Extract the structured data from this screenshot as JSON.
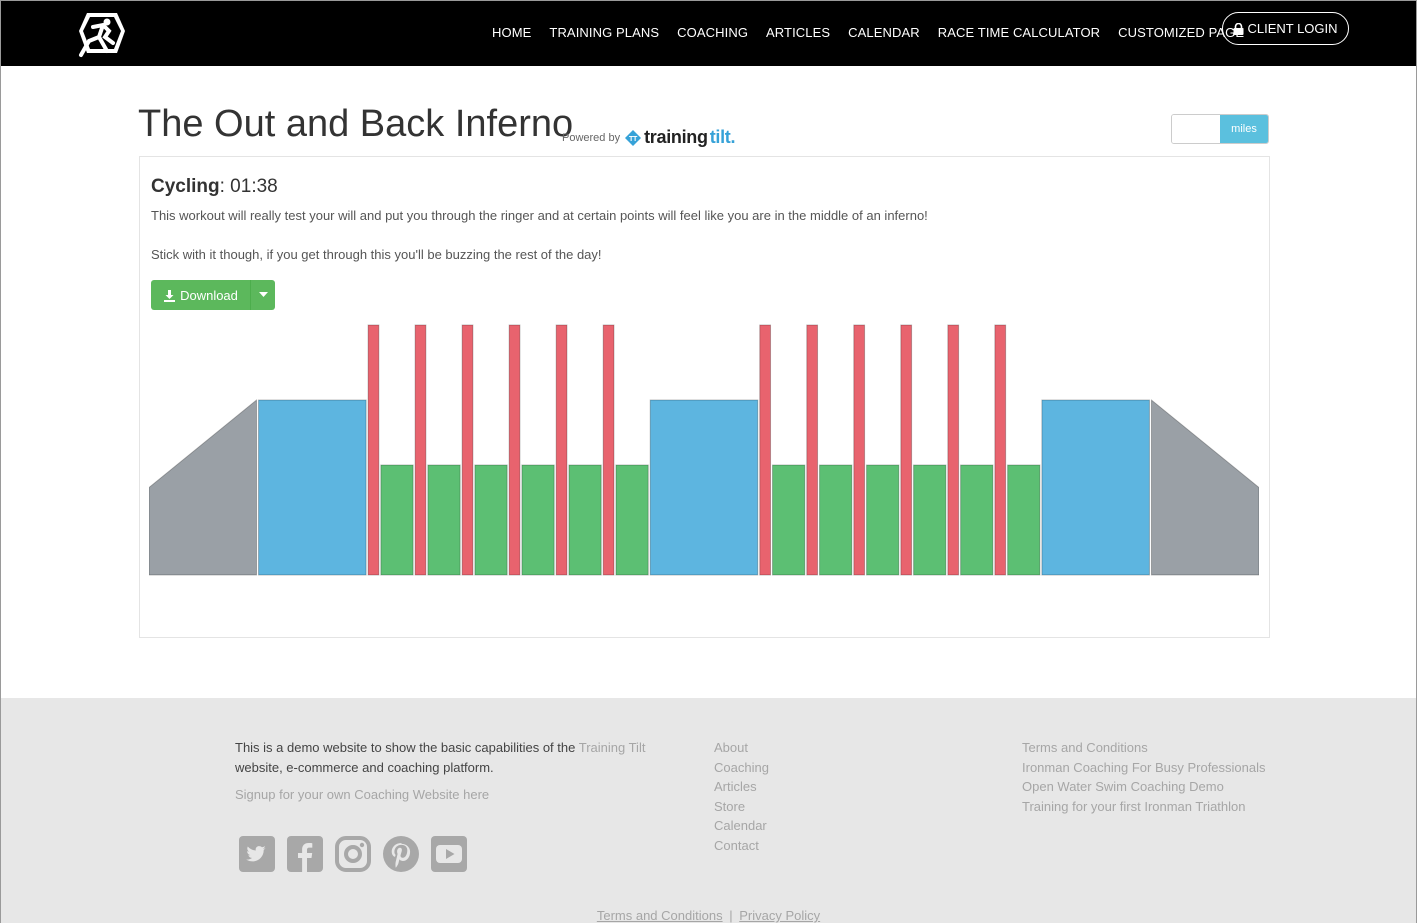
{
  "nav": {
    "items": [
      "HOME",
      "TRAINING PLANS",
      "COACHING",
      "ARTICLES",
      "CALENDAR",
      "RACE TIME CALCULATOR",
      "CUSTOMIZED PAGE"
    ],
    "login_label": "CLIENT LOGIN"
  },
  "page": {
    "title": "The Out and Back Inferno",
    "powered_by": "Powered by",
    "brand_a": "training",
    "brand_b": "tilt.",
    "unit_toggle": "miles"
  },
  "workout": {
    "sport": "Cycling",
    "duration": ": 01:38",
    "desc1": "This workout will really test your will and put you through the ringer and at certain points will feel like you are in the middle of an inferno!",
    "desc2": "Stick with it though, if you get through this you'll be buzzing the rest of the day!",
    "download_label": "Download"
  },
  "chart_data": {
    "type": "bar",
    "colors": {
      "warmup": "#9aa0a6",
      "endurance": "#5db5e0",
      "sprint": "#e8636e",
      "recovery": "#5cbf73"
    },
    "segments": [
      {
        "kind": "warmup",
        "intensity_start": 0.35,
        "intensity_end": 0.7,
        "duration": 10
      },
      {
        "kind": "endurance",
        "intensity": 0.7,
        "duration": 10
      },
      {
        "kind": "sprint",
        "intensity": 1.0,
        "duration": 1
      },
      {
        "kind": "recovery",
        "intensity": 0.44,
        "duration": 3
      },
      {
        "kind": "sprint",
        "intensity": 1.0,
        "duration": 1
      },
      {
        "kind": "recovery",
        "intensity": 0.44,
        "duration": 3
      },
      {
        "kind": "sprint",
        "intensity": 1.0,
        "duration": 1
      },
      {
        "kind": "recovery",
        "intensity": 0.44,
        "duration": 3
      },
      {
        "kind": "sprint",
        "intensity": 1.0,
        "duration": 1
      },
      {
        "kind": "recovery",
        "intensity": 0.44,
        "duration": 3
      },
      {
        "kind": "sprint",
        "intensity": 1.0,
        "duration": 1
      },
      {
        "kind": "recovery",
        "intensity": 0.44,
        "duration": 3
      },
      {
        "kind": "sprint",
        "intensity": 1.0,
        "duration": 1
      },
      {
        "kind": "recovery",
        "intensity": 0.44,
        "duration": 3
      },
      {
        "kind": "endurance",
        "intensity": 0.7,
        "duration": 10
      },
      {
        "kind": "sprint",
        "intensity": 1.0,
        "duration": 1
      },
      {
        "kind": "recovery",
        "intensity": 0.44,
        "duration": 3
      },
      {
        "kind": "sprint",
        "intensity": 1.0,
        "duration": 1
      },
      {
        "kind": "recovery",
        "intensity": 0.44,
        "duration": 3
      },
      {
        "kind": "sprint",
        "intensity": 1.0,
        "duration": 1
      },
      {
        "kind": "recovery",
        "intensity": 0.44,
        "duration": 3
      },
      {
        "kind": "sprint",
        "intensity": 1.0,
        "duration": 1
      },
      {
        "kind": "recovery",
        "intensity": 0.44,
        "duration": 3
      },
      {
        "kind": "sprint",
        "intensity": 1.0,
        "duration": 1
      },
      {
        "kind": "recovery",
        "intensity": 0.44,
        "duration": 3
      },
      {
        "kind": "sprint",
        "intensity": 1.0,
        "duration": 1
      },
      {
        "kind": "recovery",
        "intensity": 0.44,
        "duration": 3
      },
      {
        "kind": "endurance",
        "intensity": 0.7,
        "duration": 10
      },
      {
        "kind": "warmup",
        "intensity_start": 0.7,
        "intensity_end": 0.35,
        "duration": 10
      }
    ]
  },
  "footer": {
    "intro_a": "This is a demo website to show the basic capabilities of the",
    "intro_link": "Training Tilt",
    "intro_b": "website, e-commerce and coaching platform.",
    "signup": "Signup for your own Coaching Website here",
    "col1": [
      "About",
      "Coaching",
      "Articles",
      "Store",
      "Calendar",
      "Contact"
    ],
    "col2": [
      "Terms and Conditions",
      "Ironman Coaching For Busy Professionals",
      "Open Water Swim Coaching Demo",
      "Training for your first Ironman Triathlon"
    ],
    "social": [
      "twitter-icon",
      "facebook-icon",
      "instagram-icon",
      "pinterest-icon",
      "youtube-icon"
    ],
    "bottom_terms": "Terms and Conditions",
    "bottom_sep": "|",
    "bottom_privacy": "Privacy Policy"
  }
}
